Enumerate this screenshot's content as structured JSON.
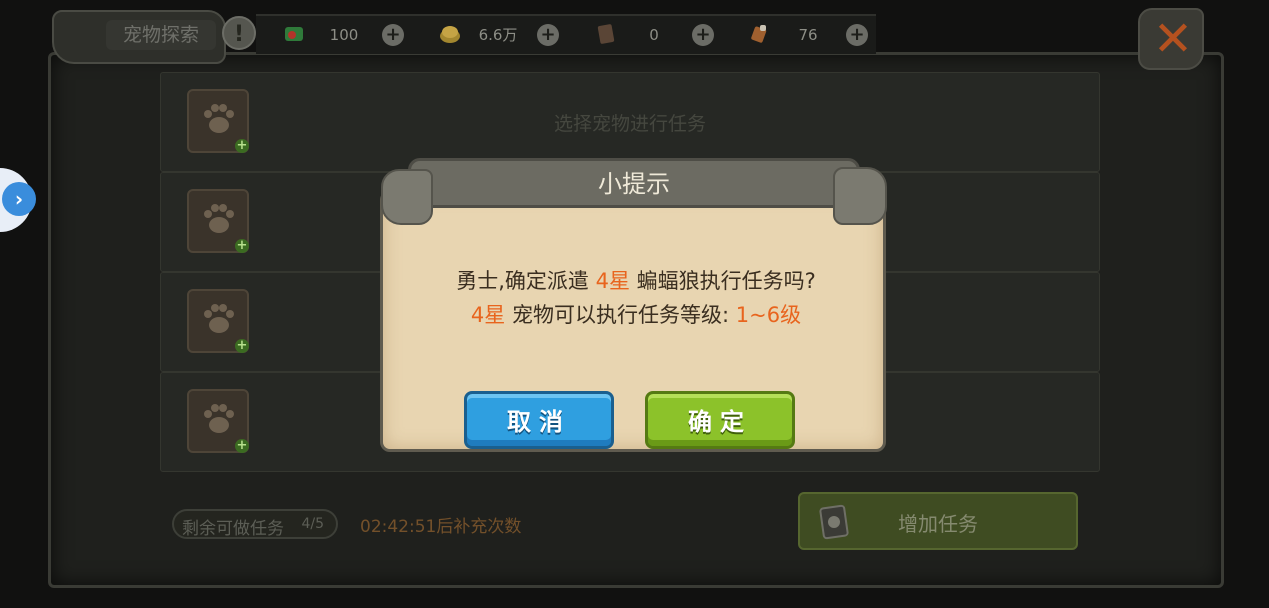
{
  "header": {
    "title": "宠物探索",
    "info_icon": "exclamation-icon",
    "close_icon": "close-x-icon"
  },
  "resources": [
    {
      "icon": "green-gem-icon",
      "value": "100"
    },
    {
      "icon": "gold-coin-icon",
      "value": "6.6万"
    },
    {
      "icon": "card-icon",
      "value": "0"
    },
    {
      "icon": "meat-icon",
      "value": "76"
    }
  ],
  "slots": [
    {
      "hint": "选择宠物进行任务"
    },
    {
      "hint": ""
    },
    {
      "hint": ""
    },
    {
      "hint": ""
    }
  ],
  "footer": {
    "remaining_label": "剩余可做任务",
    "remaining_count": "4/5",
    "timer": "02:42:51后补充次数",
    "add_task_label": "增加任务"
  },
  "dialog": {
    "title": "小提示",
    "line1_prefix": "勇士,确定派遣",
    "line1_stars": "4星",
    "line1_suffix": "蝙蝠狼执行任务吗?",
    "line2_stars": "4星",
    "line2_middle": "宠物可以执行任务等级:",
    "line2_range": "1~6级",
    "cancel_label": "取消",
    "confirm_label": "确定"
  },
  "colors": {
    "highlight": "#e8641d",
    "cancel_button": "#2f9fe0",
    "confirm_button": "#8cc22a",
    "parchment": "#e8d5b1"
  }
}
